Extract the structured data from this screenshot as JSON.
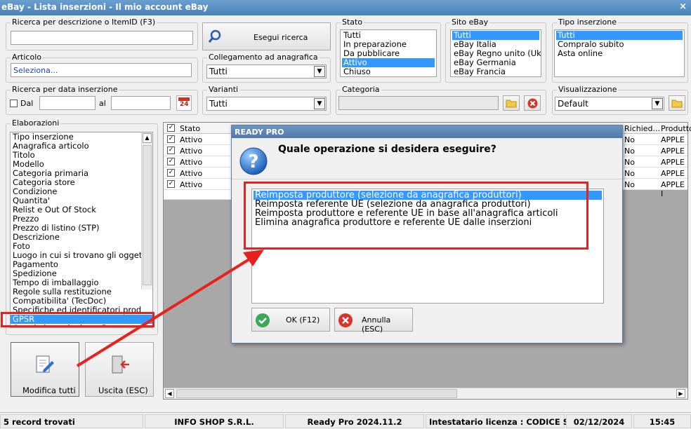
{
  "window": {
    "title": "eBay - Lista inserzioni - Il mio account eBay",
    "close_glyph": "×"
  },
  "search": {
    "desc_label": "Ricerca per descrizione o ItemID (F3)",
    "desc_value": "",
    "button_label": "Esegui ricerca"
  },
  "articolo": {
    "label": "Articolo",
    "value": "Seleziona..."
  },
  "collegamento": {
    "label": "Collegamento ad anagrafica",
    "value": "Tutti"
  },
  "stato": {
    "label": "Stato",
    "options": [
      "Tutti",
      "In preparazione",
      "Da pubblicare",
      "Attivo",
      "Chiuso"
    ],
    "selected_index": 3
  },
  "sito": {
    "label": "Sito eBay",
    "options": [
      "Tutti",
      "eBay Italia",
      "eBay Regno unito (Uk",
      "eBay Germania",
      "eBay Francia"
    ],
    "selected_index": 0
  },
  "tipo": {
    "label": "Tipo inserzione",
    "options": [
      "Tutti",
      "Compralo subito",
      "Asta online"
    ],
    "selected_index": 0
  },
  "data": {
    "label": "Ricerca per data inserzione",
    "dal_label": "Dal",
    "al_label": "al",
    "dal_value": "",
    "al_value": "",
    "calendar_day": "24"
  },
  "varianti": {
    "label": "Varianti",
    "value": "Tutti"
  },
  "categoria": {
    "label": "Categoria",
    "value": ""
  },
  "visualizzazione": {
    "label": "Visualizzazione",
    "value": "Default"
  },
  "elaborazioni": {
    "label": "Elaborazioni",
    "items": [
      "Tipo inserzione",
      "Anagrafica articolo",
      "Titolo",
      "Modello",
      "Categoria primaria",
      "Categoria store",
      "Condizione",
      "Quantita'",
      "Relist e Out Of Stock",
      "Prezzo",
      "Prezzo di listino (STP)",
      "Descrizione",
      "Foto",
      "Luogo in cui si trovano gli ogget",
      "Pagamento",
      "Spedizione",
      "Tempo di imballaggio",
      "Regole sulla restituzione",
      "Compatibilita' (TecDoc)",
      "Specifiche ed identificatori prod",
      "GPSR",
      "Crea le inserzioni su eBay"
    ],
    "selected_index": 20
  },
  "actions": {
    "modifica_label": "Modifica tutti",
    "uscita_label": "Uscita (ESC)"
  },
  "grid": {
    "columns": {
      "stato": "Stato",
      "richiesta": "Richied...",
      "produttore": "Produttore"
    },
    "rows": [
      {
        "stato": "Attivo",
        "richiesta": "No",
        "produttore": "APPLE I"
      },
      {
        "stato": "Attivo",
        "richiesta": "No",
        "produttore": "APPLE I"
      },
      {
        "stato": "Attivo",
        "richiesta": "No",
        "produttore": "APPLE I"
      },
      {
        "stato": "Attivo",
        "richiesta": "No",
        "produttore": "APPLE I"
      },
      {
        "stato": "Attivo",
        "richiesta": "No",
        "produttore": "APPLE I"
      }
    ],
    "check_glyph": "✓"
  },
  "dialog": {
    "title": "READY PRO",
    "question": "Quale operazione si desidera eseguire?",
    "options": [
      "Reimposta produttore (selezione da anagrafica produttori)",
      "Reimposta referente UE (selezione da anagrafica produttori)",
      "Reimposta produttore e referente UE in base all'anagrafica articoli",
      "Elimina anagrafica produttore e referente UE dalle inserzioni"
    ],
    "selected_index": 0,
    "ok_label": "OK (F12)",
    "cancel_label": "Annulla (ESC)"
  },
  "status": {
    "records": "5 record trovati",
    "company": "INFO SHOP S.R.L.",
    "version": "Ready Pro 2024.11.2",
    "license": "Intestatario licenza : CODICE SRL",
    "date": "02/12/2024",
    "time": "15:45"
  },
  "colors": {
    "selection": "#3399ff",
    "highlight": "#e8211f",
    "title_bar": "#4a82b8"
  }
}
